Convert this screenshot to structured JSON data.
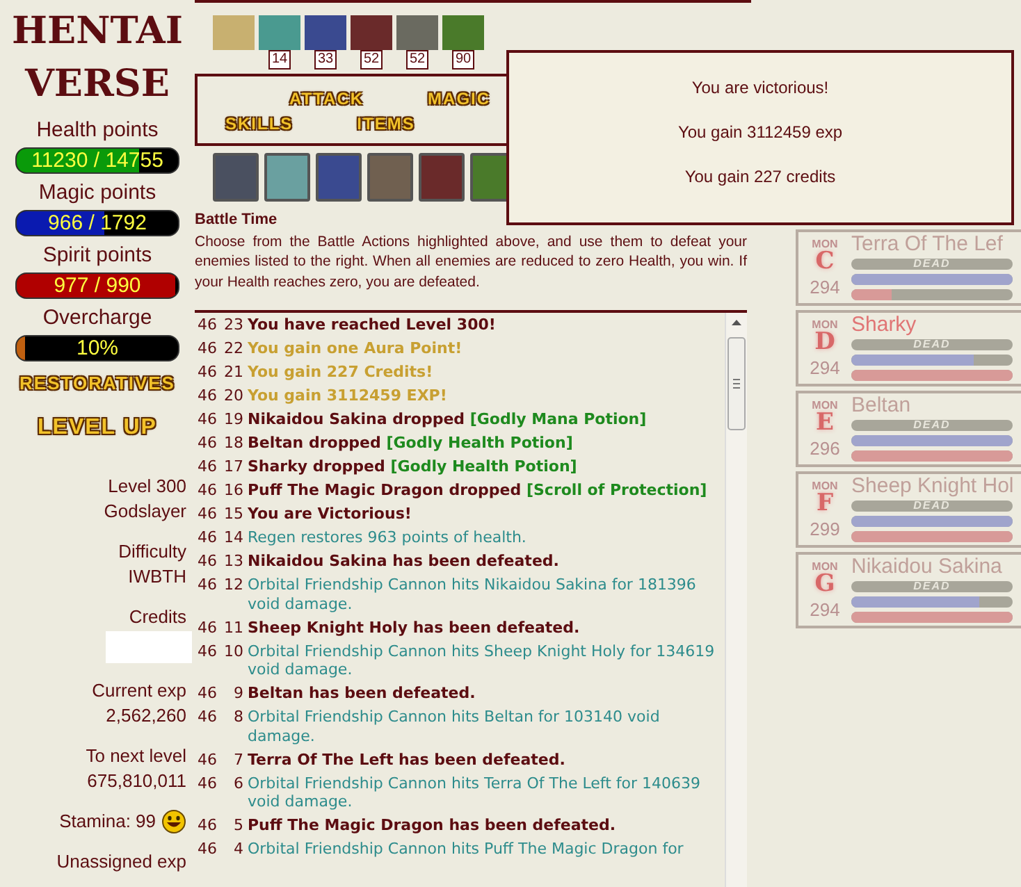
{
  "logo": {
    "line_1": "HENTAI",
    "line_2": "VERSE"
  },
  "vitals": [
    {
      "kind": "health",
      "label": "Health points",
      "value": "11230 / 14755",
      "level": 0.761
    },
    {
      "kind": "magic",
      "label": "Magic points",
      "value": "966 / 1792",
      "level": 0.539
    },
    {
      "kind": "spirit",
      "label": "Spirit points",
      "value": "977 / 990",
      "level": 0.987
    },
    {
      "kind": "overcharge",
      "label": "Overcharge",
      "value": "10%",
      "level": 0.05
    }
  ],
  "restoratives_button": "RESTORATIVES",
  "level_up_button": "LEVEL UP",
  "stats": [
    {
      "kind": "text",
      "label": "Level 300",
      "value": "Godslayer"
    },
    {
      "kind": "text",
      "label": "Difficulty",
      "value": "IWBTH"
    },
    {
      "kind": "masked",
      "label": "Credits"
    },
    {
      "kind": "text",
      "label": "Current exp",
      "value": "2,562,260"
    },
    {
      "kind": "text",
      "label": "To next level",
      "value": "675,810,011"
    },
    {
      "kind": "stamina",
      "label": "Stamina: 99"
    },
    {
      "kind": "text",
      "label": "Unassigned exp"
    }
  ],
  "effects": [
    {
      "color": "#c8b070"
    },
    {
      "color": "#4a9a90",
      "counter": "14"
    },
    {
      "color": "#3a4a90",
      "counter": "33"
    },
    {
      "color": "#6a2a2a",
      "counter": "52"
    },
    {
      "color": "#6a6a60",
      "counter": "52"
    },
    {
      "color": "#4a7a2a",
      "counter": "90"
    }
  ],
  "actions": {
    "row_1": [
      "ATTACK",
      "MAGIC"
    ],
    "row_2": [
      "SKILLS",
      "ITEMS"
    ]
  },
  "skills": [
    {
      "color": "#4a5060"
    },
    {
      "color": "#6aa0a0"
    },
    {
      "color": "#3a4a90"
    },
    {
      "color": "#706050"
    },
    {
      "color": "#6a2a2a"
    },
    {
      "color": "#4a7a2a"
    }
  ],
  "battle_info": {
    "title": "Battle Time",
    "text": "Choose from the Battle Actions highlighted above, and use them to defeat your enemies listed to the right. When all enemies are reduced to zero Health, you win. If your Health reaches zero, you are defeated."
  },
  "log": [
    {
      "round": "46",
      "turn": "23",
      "kind": "notice",
      "text": "You have reached Level 300!"
    },
    {
      "round": "46",
      "turn": "22",
      "kind": "reward",
      "text": "You gain one Aura Point!"
    },
    {
      "round": "46",
      "turn": "21",
      "kind": "reward",
      "text": "You gain 227 Credits!"
    },
    {
      "round": "46",
      "turn": "20",
      "kind": "reward",
      "text": "You gain 3112459 EXP!"
    },
    {
      "round": "46",
      "turn": "19",
      "kind": "drop",
      "text": "Nikaidou Sakina dropped",
      "item": "[Godly Mana Potion]"
    },
    {
      "round": "46",
      "turn": "18",
      "kind": "drop",
      "text": "Beltan dropped",
      "item": "[Godly Health Potion]"
    },
    {
      "round": "46",
      "turn": "17",
      "kind": "drop",
      "text": "Sharky dropped",
      "item": "[Godly Health Potion]"
    },
    {
      "round": "46",
      "turn": "16",
      "kind": "drop",
      "text": "Puff The Magic Dragon dropped",
      "item": "[Scroll of Protection]"
    },
    {
      "round": "46",
      "turn": "15",
      "kind": "notice",
      "text": "You are Victorious!"
    },
    {
      "round": "46",
      "turn": "14",
      "kind": "damage",
      "text": "Regen restores 963 points of health."
    },
    {
      "round": "46",
      "turn": "13",
      "kind": "notice",
      "text": "Nikaidou Sakina has been defeated."
    },
    {
      "round": "46",
      "turn": "12",
      "kind": "damage",
      "text": "Orbital Friendship Cannon hits Nikaidou Sakina for 181396 void damage."
    },
    {
      "round": "46",
      "turn": "11",
      "kind": "notice",
      "text": "Sheep Knight Holy has been defeated."
    },
    {
      "round": "46",
      "turn": "10",
      "kind": "damage",
      "text": "Orbital Friendship Cannon hits Sheep Knight Holy for 134619 void damage."
    },
    {
      "round": "46",
      "turn": "9",
      "kind": "notice",
      "text": "Beltan has been defeated."
    },
    {
      "round": "46",
      "turn": "8",
      "kind": "damage",
      "text": "Orbital Friendship Cannon hits Beltan for 103140 void damage."
    },
    {
      "round": "46",
      "turn": "7",
      "kind": "notice",
      "text": "Terra Of The Left has been defeated."
    },
    {
      "round": "46",
      "turn": "6",
      "kind": "damage",
      "text": "Orbital Friendship Cannon hits Terra Of The Left for 140639 void damage."
    },
    {
      "round": "46",
      "turn": "5",
      "kind": "notice",
      "text": "Puff The Magic Dragon has been defeated."
    },
    {
      "round": "46",
      "turn": "4",
      "kind": "damage",
      "text": "Orbital Friendship Cannon hits Puff The Magic Dragon for"
    }
  ],
  "monsters": [
    {
      "tag": "MON",
      "letter": "C",
      "name": "Terra Of The Lef",
      "monster_level": "294",
      "highlighted": false,
      "health": {
        "dead": true,
        "label": "DEAD"
      },
      "mana": {
        "level": 1
      },
      "spirit": {
        "level": 0.25
      }
    },
    {
      "tag": "MON",
      "letter": "D",
      "name": "Sharky",
      "monster_level": "294",
      "highlighted": true,
      "health": {
        "dead": true,
        "label": "DEAD"
      },
      "mana": {
        "level": 0.76
      },
      "spirit": {
        "level": 1
      }
    },
    {
      "tag": "MON",
      "letter": "E",
      "name": "Beltan",
      "monster_level": "296",
      "highlighted": false,
      "health": {
        "dead": true,
        "label": "DEAD"
      },
      "mana": {
        "level": 1
      },
      "spirit": {
        "level": 1
      }
    },
    {
      "tag": "MON",
      "letter": "F",
      "name": "Sheep Knight Hol",
      "monster_level": "299",
      "highlighted": false,
      "health": {
        "dead": true,
        "label": "DEAD"
      },
      "mana": {
        "level": 1
      },
      "spirit": {
        "level": 1
      }
    },
    {
      "tag": "MON",
      "letter": "G",
      "name": "Nikaidou Sakina",
      "monster_level": "294",
      "highlighted": false,
      "health": {
        "dead": true,
        "label": "DEAD"
      },
      "mana": {
        "level": 0.79
      },
      "spirit": {
        "level": 1
      }
    }
  ],
  "victory_dialog": {
    "lines": [
      "You are victorious!",
      "You gain 3112459 exp",
      "You gain 227 credits"
    ]
  }
}
